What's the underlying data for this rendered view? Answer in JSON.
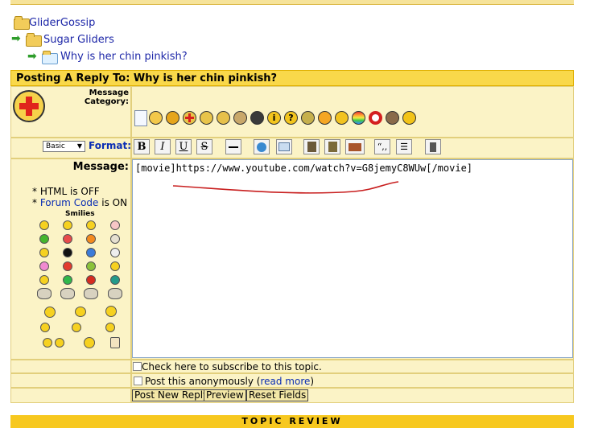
{
  "breadcrumb": {
    "forum": "GliderGossip",
    "category": "Sugar Gliders",
    "topic": "Why is her chin pinkish?"
  },
  "header": {
    "title": "Posting A Reply To: Why is her chin pinkish?"
  },
  "form": {
    "message_category_label": "Message Category:",
    "format_label": "Format:",
    "format_mode": "Basic",
    "message_label": "Message:",
    "html_status": "* HTML is OFF",
    "forum_code_prefix": "*",
    "forum_code_link": "Forum Code",
    "forum_code_status": "is ON",
    "smilies_label": "Smilies",
    "message_text": "[movie]https://www.youtube.com/watch?v=G8jemyC8WUw[/movie]",
    "subscribe_label": "Check here to subscribe to this topic.",
    "anon_prefix": "Post this anonymously (",
    "anon_link": "read more",
    "anon_suffix": ")",
    "btn_post": "Post New Reply",
    "btn_preview": "Preview",
    "btn_reset": "Reset Fields"
  },
  "toolbar": {
    "bold": "B",
    "italic": "I",
    "underline": "U",
    "strike": "S",
    "quote": "“,,",
    "icons": [
      "bold-icon",
      "italic-icon",
      "underline-icon",
      "strikethrough-icon",
      "horizontal-rule-icon",
      "insert-link-icon",
      "insert-email-icon",
      "insert-image-icon",
      "insert-image-alt-icon",
      "insert-book-icon",
      "quote-icon",
      "list-icon",
      "insert-tool-icon"
    ]
  },
  "category_icons": [
    "document-icon",
    "eye-roll-icon",
    "apple-icon",
    "red-cross-icon",
    "scales-icon",
    "atom-icon",
    "mona-lisa-icon",
    "portrait-icon",
    "info-icon",
    "question-icon",
    "shield-icon",
    "fire-icon",
    "sun-icon",
    "rainbow-icon",
    "life-ring-icon",
    "globe-icon",
    "radiation-icon"
  ],
  "footer": {
    "label": "TOPIC REVIEW"
  },
  "colors": {
    "header_bg": "#f9d84a",
    "panel_bg": "#fbf3c6",
    "link": "#0a2db4",
    "annotation": "#c81e1e",
    "footer_bg": "#f7c81f"
  }
}
